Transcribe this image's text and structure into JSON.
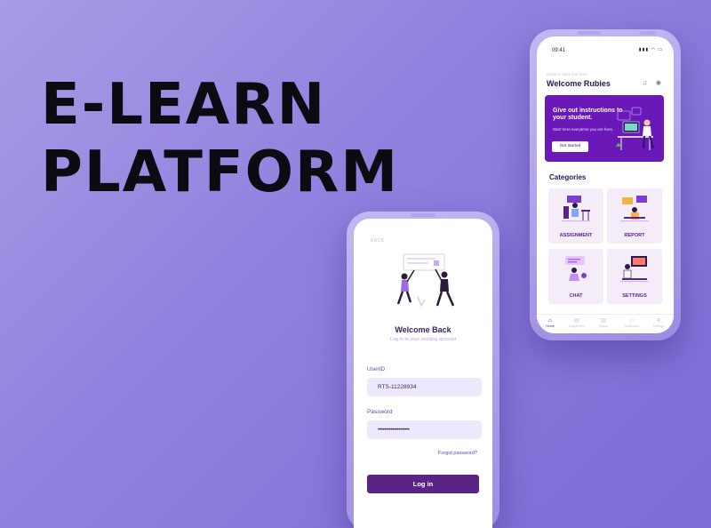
{
  "headline": {
    "line1": "E-LEARN",
    "line2": "PLATFORM"
  },
  "login": {
    "back_label": "BACK",
    "title": "Welcome Back",
    "subtitle": "Log in to your existing account",
    "userid_label": "UserID",
    "userid_value": "RTS-11228934",
    "password_label": "Password",
    "password_value": "••••••••••••••••••••",
    "forgot_link": "Forgot password?",
    "login_button": "Log in"
  },
  "home": {
    "status_time": "09:41",
    "greeting_small": "Good to have you here",
    "greeting": "Welcome Rubies",
    "banner": {
      "title": "Give out instructions to your student.",
      "subtitle": "Start here everytime you are here.",
      "button": "Get started"
    },
    "categories_title": "Categories",
    "categories": [
      {
        "label": "ASSIGNMENT",
        "icon": "assignment-illustration"
      },
      {
        "label": "REPORT",
        "icon": "report-illustration"
      },
      {
        "label": "CHAT",
        "icon": "chat-illustration"
      },
      {
        "label": "SETTINGS",
        "icon": "settings-illustration"
      }
    ],
    "tabs": [
      {
        "label": "Home",
        "icon": "home-icon",
        "active": true
      },
      {
        "label": "Assignment",
        "icon": "assignment-icon"
      },
      {
        "label": "Report",
        "icon": "report-icon"
      },
      {
        "label": "Notification",
        "icon": "notification-icon"
      },
      {
        "label": "Settings",
        "icon": "settings-icon"
      }
    ]
  },
  "colors": {
    "background": "#8f7fde",
    "primary": "#5a2486",
    "banner": "#6a18b8",
    "card": "#f5ecfa"
  }
}
